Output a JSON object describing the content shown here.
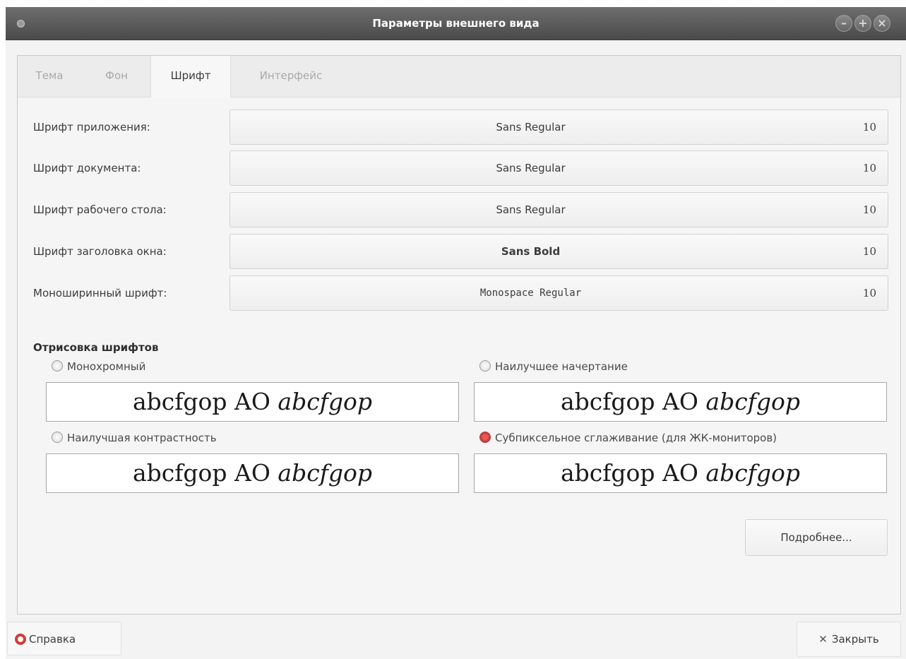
{
  "window": {
    "title": "Параметры внешнего вида"
  },
  "titlebar_buttons": [
    "–",
    "+",
    "×"
  ],
  "tabs": [
    {
      "label": "Тема",
      "active": false
    },
    {
      "label": "Фон",
      "active": false
    },
    {
      "label": "Шрифт",
      "active": true
    },
    {
      "label": "Интерфейс",
      "active": false
    }
  ],
  "fonts": [
    {
      "label": "Шрифт приложения:",
      "font": "Sans Regular",
      "size": "10"
    },
    {
      "label": "Шрифт документа:",
      "font": "Sans Regular",
      "size": "10"
    },
    {
      "label": "Шрифт рабочего стола:",
      "font": "Sans Regular",
      "size": "10"
    },
    {
      "label": "Шрифт заголовка окна:",
      "font": "Sans Bold",
      "size": "10"
    },
    {
      "label": "Моноширинный шрифт:",
      "font": "Monospace Regular",
      "size": "10"
    }
  ],
  "rendering": {
    "title": "Отрисовка шрифтов",
    "sample_regular": "abcfgop AO ",
    "sample_italic": "abcfgop",
    "options": [
      {
        "label": "Монохромный",
        "selected": false
      },
      {
        "label": "Наилучшее начертание",
        "selected": false
      },
      {
        "label": "Наилучшая контрастность",
        "selected": false
      },
      {
        "label": "Субпиксельное сглаживание (для ЖК-мониторов)",
        "selected": true
      }
    ]
  },
  "details_button": "Подробнее...",
  "help_button": "Справка",
  "close_button": "Закрыть",
  "colors": {
    "titlebar": "#5a5a5a",
    "selected_radio": "#c0392b"
  }
}
